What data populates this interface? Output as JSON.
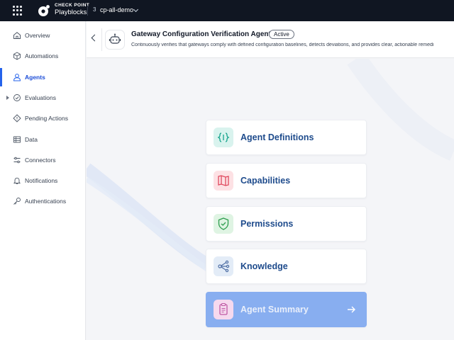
{
  "topbar": {
    "brand_small": "CHECK POINT",
    "brand_main": "Playblocks",
    "env_icon": "3",
    "env_name": "cp-all-demo"
  },
  "sidebar": {
    "items": [
      {
        "label": "Overview",
        "icon": "home-icon"
      },
      {
        "label": "Automations",
        "icon": "cube-icon"
      },
      {
        "label": "Agents",
        "icon": "agent-icon",
        "active": true
      },
      {
        "label": "Evaluations",
        "icon": "evaluation-icon"
      },
      {
        "label": "Pending Actions",
        "icon": "diamond-icon"
      },
      {
        "label": "Data",
        "icon": "table-icon"
      },
      {
        "label": "Connectors",
        "icon": "connectors-icon"
      },
      {
        "label": "Notifications",
        "icon": "bell-icon"
      },
      {
        "label": "Authentications",
        "icon": "key-icon"
      }
    ]
  },
  "header": {
    "title": "Gateway Configuration Verification Agent",
    "status": "Active",
    "description": "Continuously verifies that gateways comply with defined configuration baselines, detects deviations, and provides clear, actionable remedi"
  },
  "cards": [
    {
      "label": "Agent Definitions",
      "icon": "definitions-icon",
      "icon_bg": "#d9f3ee",
      "icon_color": "#14a38b"
    },
    {
      "label": "Capabilities",
      "icon": "map-icon",
      "icon_bg": "#fde1e4",
      "icon_color": "#e04a5f"
    },
    {
      "label": "Permissions",
      "icon": "shield-icon",
      "icon_bg": "#dff4e3",
      "icon_color": "#2f9e4f"
    },
    {
      "label": "Knowledge",
      "icon": "network-icon",
      "icon_bg": "#e3ecf7",
      "icon_color": "#4f6fa5"
    },
    {
      "label": "Agent Summary",
      "icon": "document-icon",
      "icon_bg": "#f6d9ee",
      "icon_color": "#c05aa5"
    }
  ],
  "colors": {
    "accent": "#2563eb",
    "topbar_bg": "#101622",
    "card_text": "#1e4b8c",
    "summary_bg": "#88aef0"
  }
}
